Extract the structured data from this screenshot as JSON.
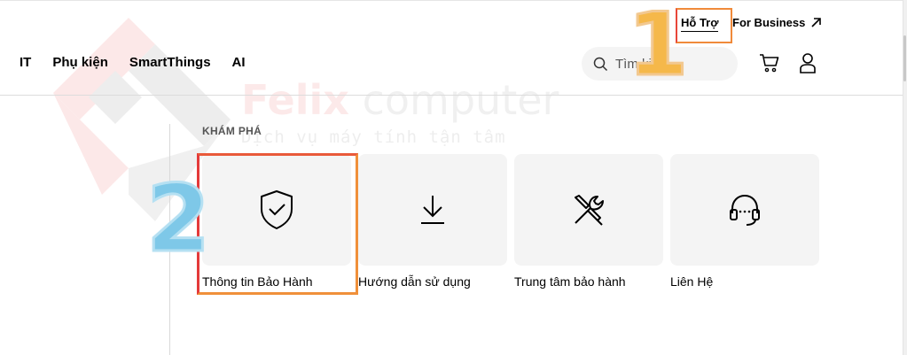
{
  "watermark": {
    "brand_a": "Felix",
    "brand_b": " computer",
    "tagline": "Dịch vụ máy tính tận tâm"
  },
  "utility": {
    "support_label": "Hỗ Trợ",
    "business_label": "For Business"
  },
  "nav": {
    "items": [
      {
        "label": "IT"
      },
      {
        "label": "Phụ kiện"
      },
      {
        "label": "SmartThings"
      },
      {
        "label": "AI"
      }
    ]
  },
  "search": {
    "placeholder": "Tìm kiếm"
  },
  "icons": {
    "search": "search-icon",
    "cart": "cart-icon",
    "user": "user-icon",
    "external": "arrow-up-right-icon"
  },
  "explore": {
    "heading": "KHÁM PHÁ",
    "cards": [
      {
        "label": "Thông tin Bảo Hành",
        "icon": "shield-check-icon"
      },
      {
        "label": "Hướng dẫn sử dụng",
        "icon": "download-icon"
      },
      {
        "label": "Trung tâm bảo hành",
        "icon": "tools-icon"
      },
      {
        "label": "Liên Hệ",
        "icon": "headset-icon"
      }
    ]
  },
  "annotations": {
    "step_1": "1",
    "step_2": "2",
    "colors": {
      "orange": "#f08a3a",
      "red": "#e43a3a",
      "number_1": "#f5b84a",
      "number_2": "#7ec8e8"
    }
  }
}
